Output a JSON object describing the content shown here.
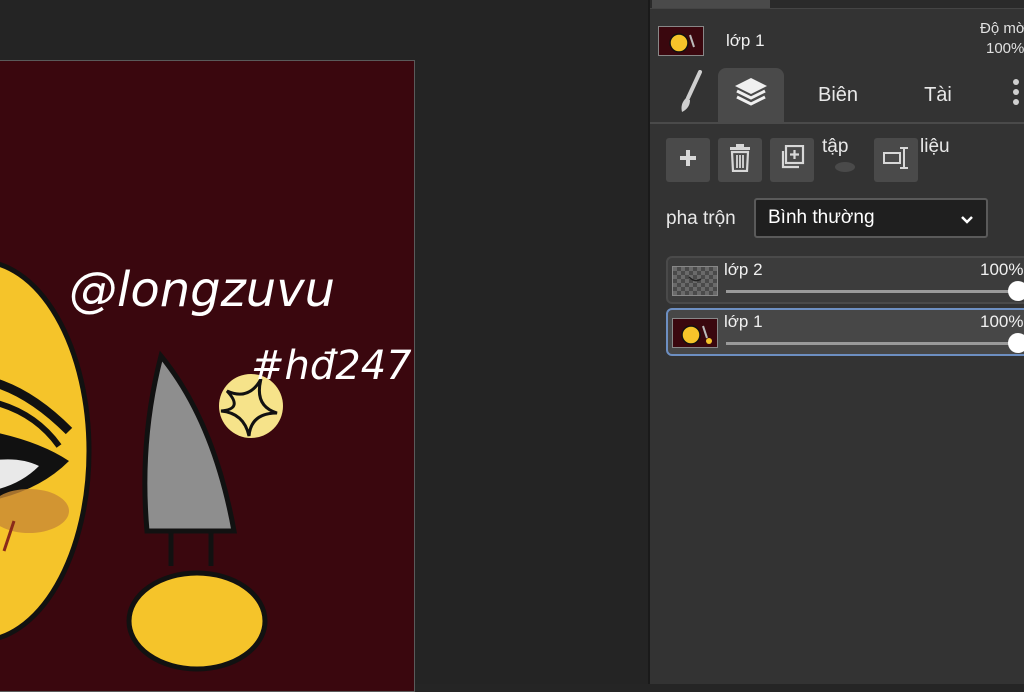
{
  "canvas": {
    "background_color": "#3a070e",
    "artwork_text_line1": "@longzuvu",
    "artwork_text_line2": "#hđ247"
  },
  "layer_panel": {
    "current_layer": {
      "name": "lớp 1",
      "opacity_label": "Độ mờ",
      "opacity_value": "100%"
    },
    "tabs": [
      {
        "icon": "brush-icon",
        "label": ""
      },
      {
        "icon": "layers-icon",
        "label": "",
        "active": true
      },
      {
        "label": "Biên"
      },
      {
        "label": "Tài"
      },
      {
        "icon": "more-vertical-icon",
        "label": ""
      }
    ],
    "toolbar": {
      "add_icon": "plus-icon",
      "delete_icon": "trash-icon",
      "duplicate_icon": "duplicate-layer-icon",
      "merge_label": "tập",
      "extra_icon": "layer-properties-icon",
      "extra_label": "liệu"
    },
    "blend": {
      "label": "pha trộn",
      "value": "Bình thường"
    },
    "layers": [
      {
        "name": "lớp 2",
        "opacity": "100%",
        "opacity_fraction": 1.0,
        "selected": false
      },
      {
        "name": "lớp 1",
        "opacity": "100%",
        "opacity_fraction": 1.0,
        "selected": true
      }
    ]
  }
}
